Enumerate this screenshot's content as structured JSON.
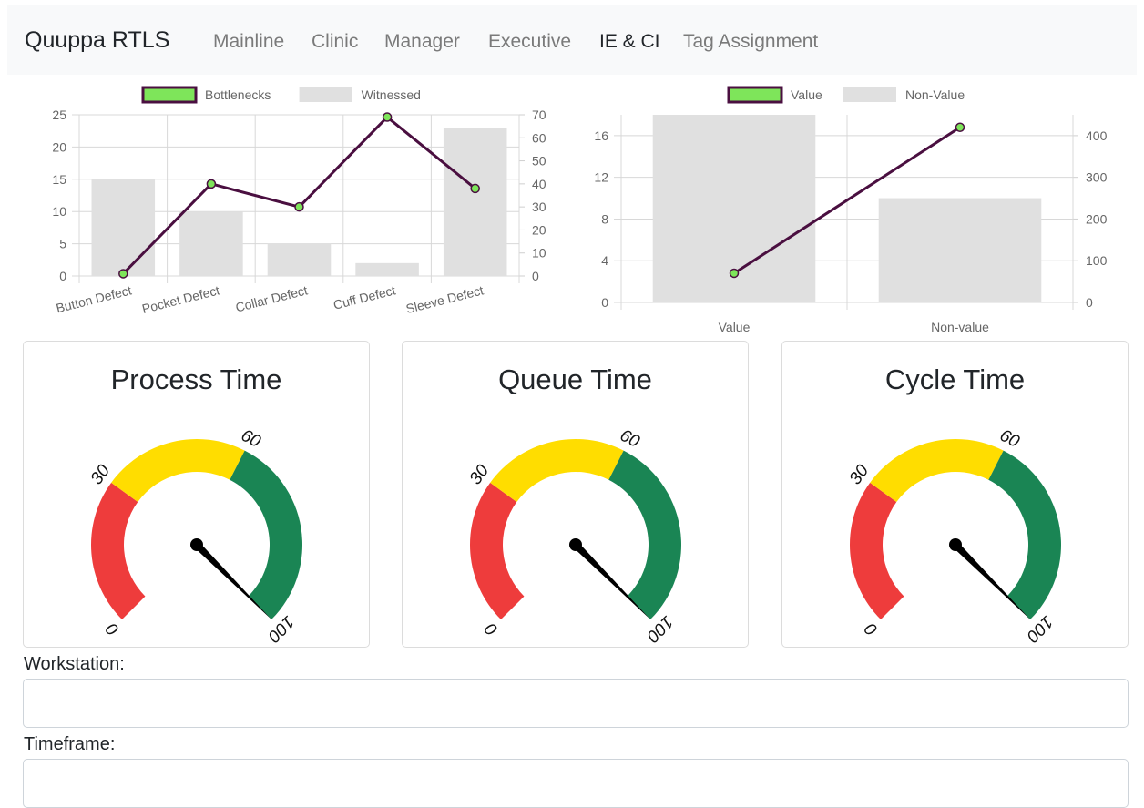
{
  "navbar": {
    "brand": "Quuppa RTLS",
    "links": [
      {
        "label": "Mainline",
        "active": false
      },
      {
        "label": "Clinic",
        "active": false
      },
      {
        "label": "Manager",
        "active": false
      },
      {
        "label": "Executive",
        "active": false
      },
      {
        "label": "IE & CI",
        "active": true
      },
      {
        "label": "Tag Assignment",
        "active": false
      }
    ]
  },
  "colors": {
    "line": "#4a0f40",
    "point_fill": "#7ee55a",
    "bar": "#e0e0e0",
    "gauge_red": "#ee3c3c",
    "gauge_yellow": "#ffdd00",
    "gauge_green": "#1a8554"
  },
  "chart_data": [
    {
      "type": "bar",
      "categories": [
        "Button Defect",
        "Pocket Defect",
        "Collar Defect",
        "Cuff Defect",
        "Sleeve Defect"
      ],
      "series": [
        {
          "name": "Witnessed",
          "type": "bar",
          "axis": "left",
          "values": [
            15,
            10,
            5,
            2,
            23
          ]
        },
        {
          "name": "Bottlenecks",
          "type": "line",
          "axis": "right",
          "values": [
            1,
            40,
            30,
            69,
            38
          ]
        }
      ],
      "ylim": [
        0,
        25
      ],
      "y_ticks": [
        0,
        5,
        10,
        15,
        20,
        25
      ],
      "y2lim": [
        0,
        70
      ],
      "y2_ticks": [
        0,
        10,
        20,
        30,
        40,
        50,
        60,
        70
      ],
      "legend": "top",
      "grid": true
    },
    {
      "type": "bar",
      "categories": [
        "Value",
        "Non-value"
      ],
      "series": [
        {
          "name": "Non-Value",
          "type": "bar",
          "axis": "left",
          "values": [
            18,
            10
          ]
        },
        {
          "name": "Value",
          "type": "line",
          "axis": "right",
          "values": [
            70,
            420
          ]
        }
      ],
      "ylim": [
        0,
        18
      ],
      "y_ticks": [
        0,
        4,
        8,
        12,
        16
      ],
      "y2lim": [
        0,
        450
      ],
      "y2_ticks": [
        0,
        100,
        200,
        300,
        400
      ],
      "legend": "top",
      "grid": true
    }
  ],
  "gauges": [
    {
      "title": "Process Time",
      "value": 100,
      "min": 0,
      "max": 100,
      "ticks": [
        "0",
        "30",
        "60",
        "100"
      ],
      "bands": [
        30,
        60,
        100
      ]
    },
    {
      "title": "Queue Time",
      "value": 100,
      "min": 0,
      "max": 100,
      "ticks": [
        "0",
        "30",
        "60",
        "100"
      ],
      "bands": [
        30,
        60,
        100
      ]
    },
    {
      "title": "Cycle Time",
      "value": 100,
      "min": 0,
      "max": 100,
      "ticks": [
        "0",
        "30",
        "60",
        "100"
      ],
      "bands": [
        30,
        60,
        100
      ]
    }
  ],
  "form": {
    "workstation_label": "Workstation:",
    "workstation_value": "",
    "timeframe_label": "Timeframe:",
    "timeframe_value": ""
  }
}
